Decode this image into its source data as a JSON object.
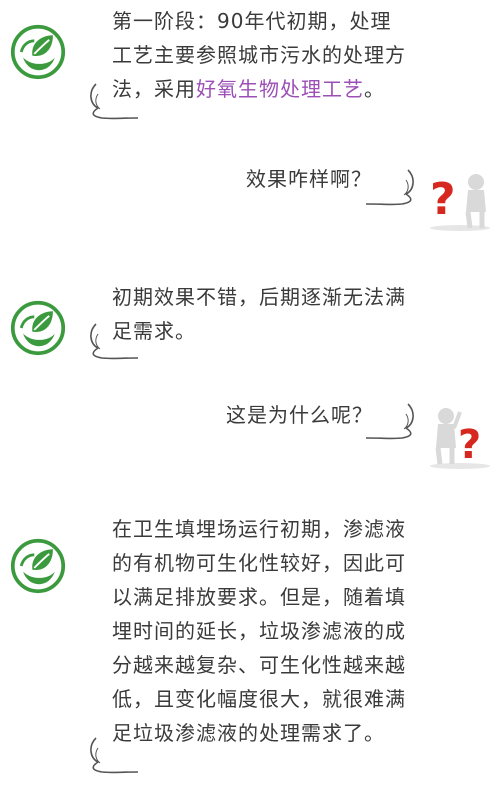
{
  "messages": [
    {
      "side": "left",
      "lines": [
        "第一阶段：90年代初期，处理",
        "工艺主要参照城市污水的处理方",
        "法，采用"
      ],
      "highlight": "好氧生物处理工艺",
      "tail_text": "。"
    },
    {
      "side": "right",
      "text": "效果咋样啊？"
    },
    {
      "side": "left",
      "lines": [
        "初期效果不错，后期逐渐无法满",
        "足需求。"
      ]
    },
    {
      "side": "right",
      "text": "这是为什么呢？"
    },
    {
      "side": "left",
      "lines": [
        "在卫生填埋场运行初期，渗滤液",
        "的有机物可生化性较好，因此可",
        "以满足排放要求。但是，随着填",
        "埋时间的延长，垃圾渗滤液的成",
        "分越来越复杂、可生化性越来越",
        "低，且变化幅度很大，就很难满",
        "足垃圾渗滤液的处理需求了。"
      ]
    }
  ],
  "colors": {
    "logo_green": "#3c9a3e",
    "highlight": "#9c4fb6",
    "question_red": "#d6281e"
  },
  "icons": [
    "leaf-logo-icon",
    "question-person-icon"
  ]
}
